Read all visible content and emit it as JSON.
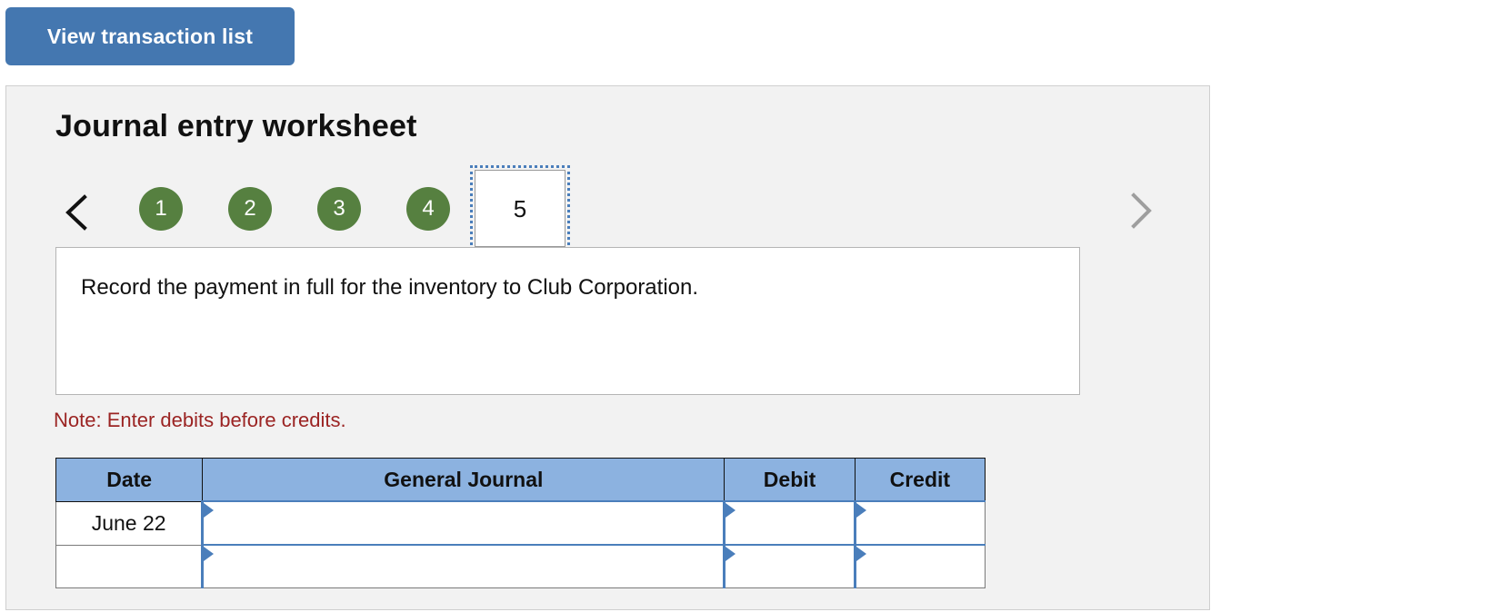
{
  "toolbar": {
    "view_transaction_list_label": "View transaction list"
  },
  "worksheet": {
    "title": "Journal entry worksheet",
    "pager": {
      "prev_icon": "chevron-left-icon",
      "next_icon": "chevron-right-icon",
      "steps": [
        "1",
        "2",
        "3",
        "4"
      ],
      "current_step": "5"
    },
    "prompt": "Record the payment in full for the inventory to Club Corporation.",
    "note": "Note: Enter debits before credits.",
    "table": {
      "headers": [
        "Date",
        "General Journal",
        "Debit",
        "Credit"
      ],
      "rows": [
        {
          "date": "June 22",
          "general_journal": "",
          "debit": "",
          "credit": ""
        },
        {
          "date": "",
          "general_journal": "",
          "debit": "",
          "credit": ""
        }
      ]
    }
  },
  "colors": {
    "button_blue": "#4477b0",
    "step_green": "#568040",
    "header_blue": "#8cb2e0",
    "note_red": "#9b2423",
    "focus_blue": "#4a7ebb",
    "panel_bg": "#f2f2f2"
  }
}
